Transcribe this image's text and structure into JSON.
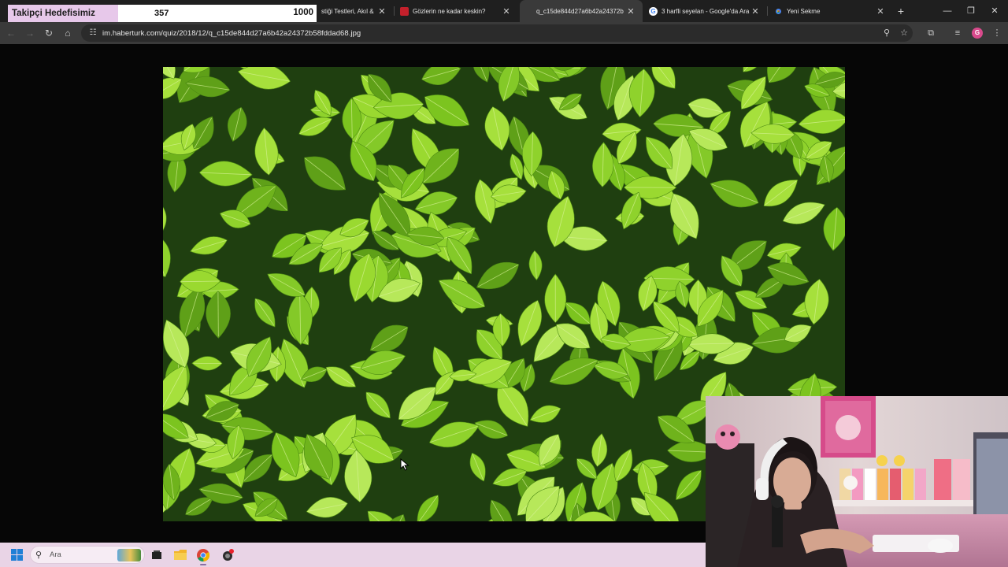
{
  "overlay": {
    "label": "Takipçi Hedefisimiz",
    "current": "357",
    "goal": "1000",
    "progress": 0.357,
    "fill_color": "#e7c8ea"
  },
  "tabs": [
    {
      "title": "stiği Testleri, Akıl &",
      "favicon": "partial",
      "active": false
    },
    {
      "title": "Gözlerin ne kadar keskin?",
      "favicon": "haberturk-icon",
      "active": false
    },
    {
      "title": "q_c15de844d27a6b42a24372b",
      "favicon": "none",
      "active": true
    },
    {
      "title": "3 harfli seyelan - Google'da Ara",
      "favicon": "google-icon",
      "active": false
    },
    {
      "title": "Yeni Sekme",
      "favicon": "chrome-icon",
      "active": false
    }
  ],
  "address_bar": {
    "url": "im.haberturk.com/quiz/2018/12/q_c15de844d27a6b42a24372b58fddad68.jpg"
  },
  "content": {
    "image_subject": "green leaves",
    "background": "#060606"
  },
  "taskbar": {
    "search_placeholder": "Ara",
    "apps": [
      "file-explorer-icon",
      "folder-icon",
      "chrome-icon",
      "app-icon"
    ]
  },
  "profile_initial": "G"
}
